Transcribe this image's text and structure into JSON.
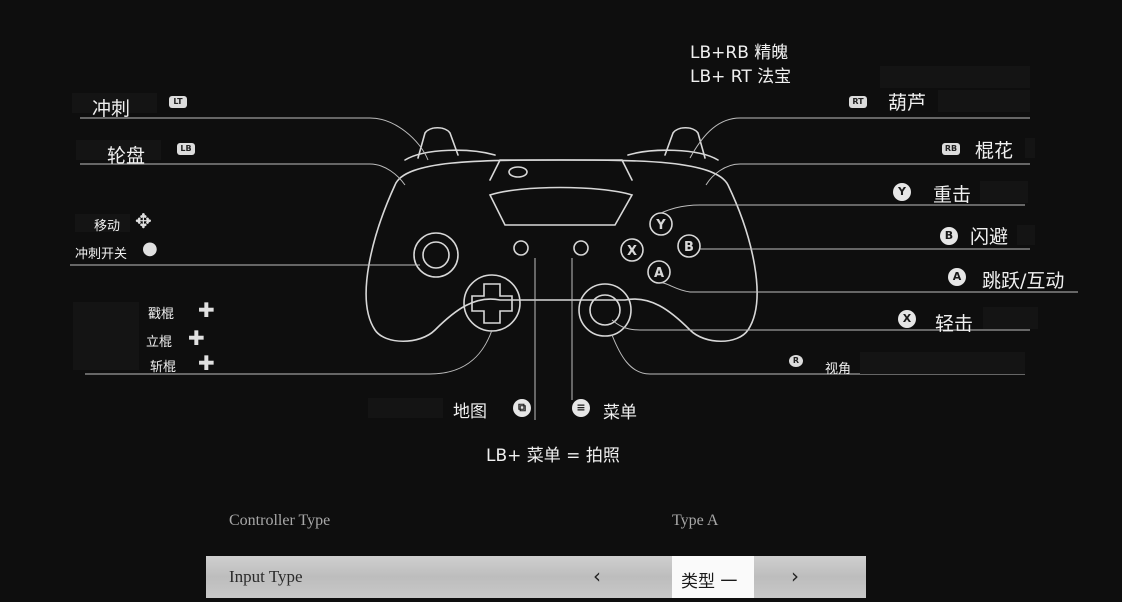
{
  "top_notes": {
    "lb_rb": "LB+RB  精魄",
    "lb_rt": "LB+ RT  法宝"
  },
  "left": {
    "sprint": "冲刺",
    "wheel": "轮盘",
    "move": "移动",
    "sprint_toggle": "冲刺开关",
    "stance_smash": "戳棍",
    "stance_pillar": "立棍",
    "stance_thrust": "斩棍"
  },
  "right": {
    "gourd": "葫芦",
    "staff_spin": "棍花",
    "heavy_attack": "重击",
    "dodge": "闪避",
    "jump_interact": "跳跃/互动",
    "light_attack": "轻击",
    "camera": "视角"
  },
  "bottom": {
    "map": "地图",
    "menu": "菜单",
    "photo": "LB+ 菜单 = 拍照"
  },
  "badges": {
    "lt": "LT",
    "lb": "LB",
    "rt": "RT",
    "rb": "RB",
    "r": "R"
  },
  "buttons": {
    "y": "Y",
    "b": "B",
    "a": "A",
    "x": "X"
  },
  "settings": {
    "controller_type_label": "Controller Type",
    "controller_type_value": "Type A",
    "input_type_label": "Input Type",
    "input_type_value": "类型 一",
    "prev": "‹",
    "next": "›"
  }
}
